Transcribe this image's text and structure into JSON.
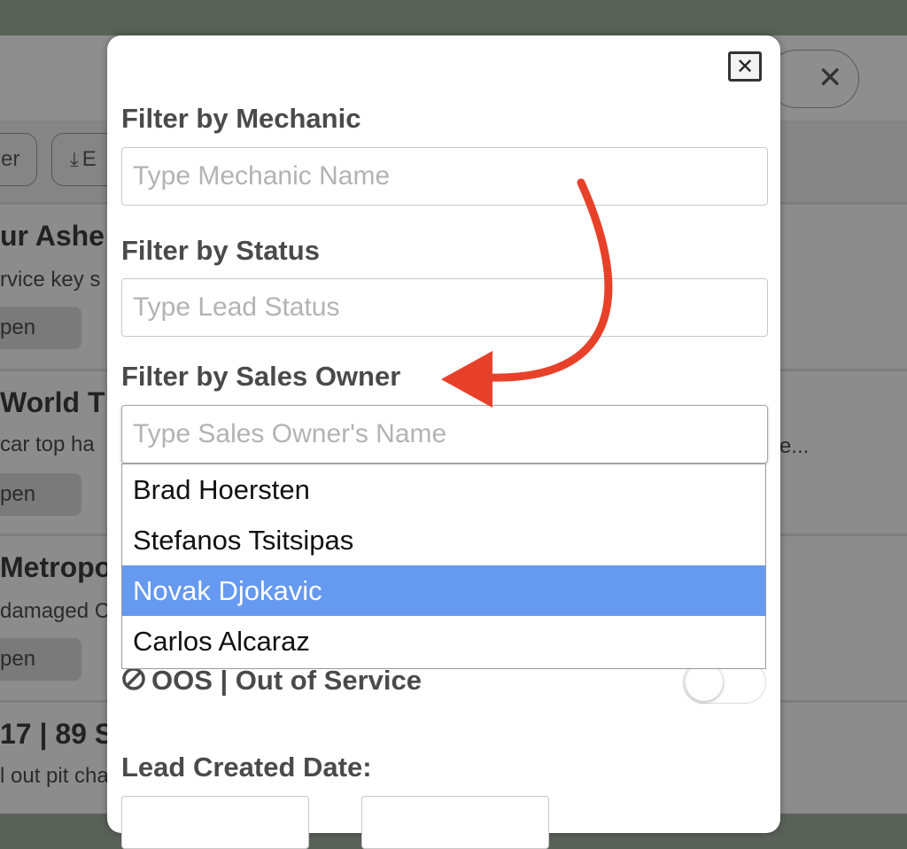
{
  "background": {
    "buttons": [
      "er",
      "E"
    ],
    "cards": [
      {
        "title": "ur Ashe",
        "text": "rvice key s",
        "pill": "pen"
      },
      {
        "title": "World T",
        "text": "car top ha",
        "pill": "pen"
      },
      {
        "title": "Metropo",
        "text": "damaged C",
        "pill": "pen"
      },
      {
        "title": "17 | 89 S",
        "text": "l out pit cha"
      }
    ],
    "right_ellipsis": "e..."
  },
  "modal": {
    "mechanic": {
      "label": "Filter by Mechanic",
      "placeholder": "Type Mechanic Name",
      "value": ""
    },
    "status": {
      "label": "Filter by Status",
      "placeholder": "Type Lead Status",
      "value": ""
    },
    "sales_owner": {
      "label": "Filter by Sales Owner",
      "placeholder": "Type Sales Owner's Name",
      "value": "",
      "options": [
        {
          "label": "Brad Hoersten",
          "selected": false
        },
        {
          "label": "Stefanos Tsitsipas",
          "selected": false
        },
        {
          "label": "Novak Djokavic",
          "selected": true
        },
        {
          "label": "Carlos Alcaraz",
          "selected": false
        }
      ]
    },
    "oos": {
      "label": "OOS | Out of Service",
      "enabled": false
    },
    "date": {
      "label": "Lead Created Date:"
    }
  },
  "colors": {
    "highlight": "#6699f0",
    "annotation_arrow": "#e8412a"
  },
  "icons": [
    "close-icon",
    "download-icon",
    "modal-close-icon",
    "no-entry-icon"
  ]
}
